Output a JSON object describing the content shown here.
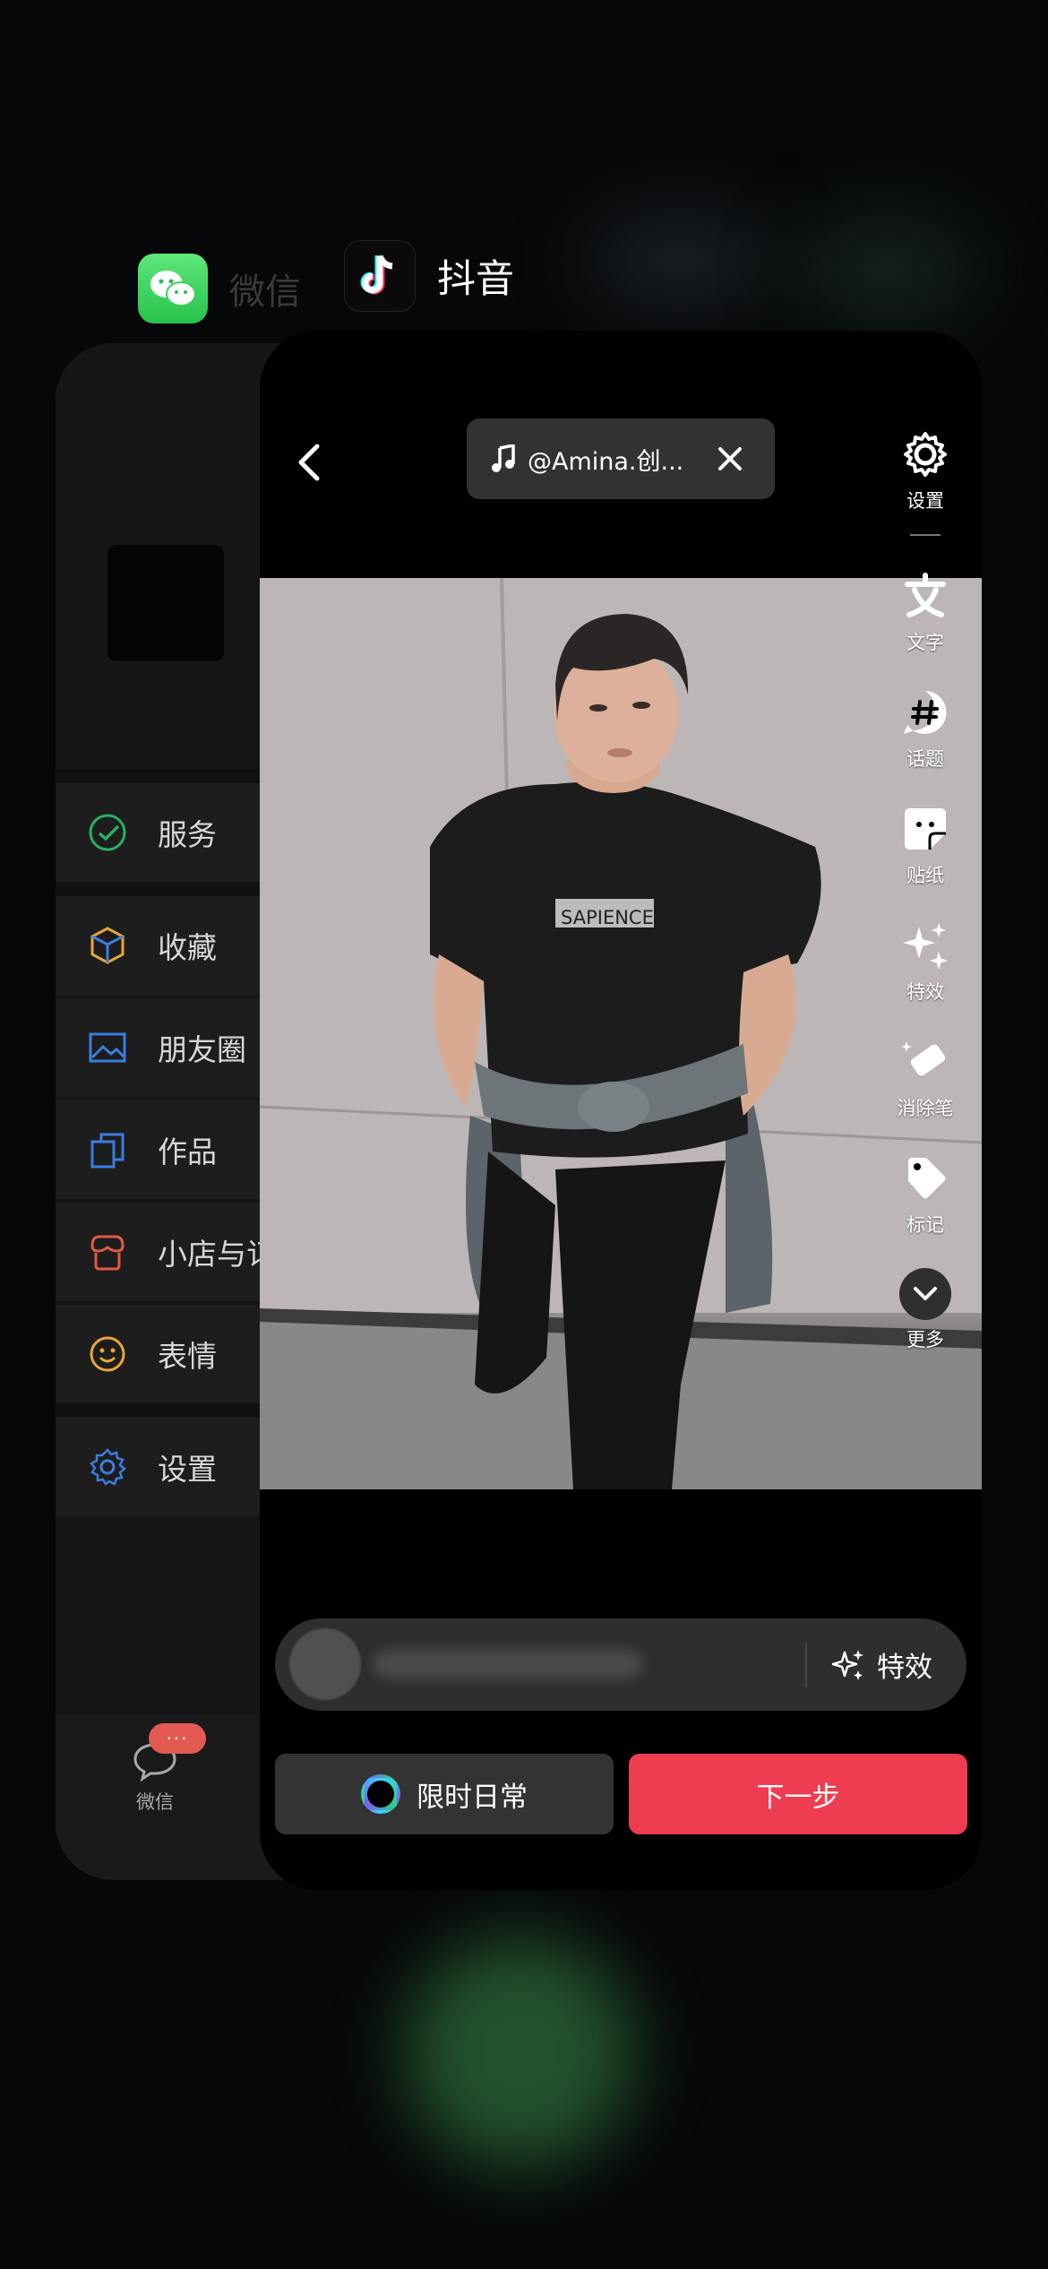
{
  "switcher": {
    "wechat_app_name": "微信",
    "douyin_app_name": "抖音"
  },
  "wechat": {
    "menu": [
      {
        "label": "服务",
        "icon": "service-icon",
        "color": "#2aae67"
      },
      {
        "label": "收藏",
        "icon": "cube-icon",
        "color": "#e6a63a"
      },
      {
        "label": "朋友圈",
        "icon": "image-icon",
        "color": "#3b7de0"
      },
      {
        "label": "作品",
        "icon": "copy-icon",
        "color": "#3b7de0"
      },
      {
        "label": "小店与订",
        "icon": "shop-icon",
        "color": "#e05a4a"
      },
      {
        "label": "表情",
        "icon": "smile-icon",
        "color": "#e6a63a"
      },
      {
        "label": "设置",
        "icon": "gear-icon",
        "color": "#3b7de0"
      }
    ],
    "tabbar": {
      "label": "微信",
      "badge": "···"
    }
  },
  "douyin": {
    "music_label": "@Amina.创...",
    "tools": [
      {
        "label": "设置",
        "icon": "gear-icon"
      },
      {
        "label": "文字",
        "icon": "text-icon"
      },
      {
        "label": "话题",
        "icon": "hashtag-icon"
      },
      {
        "label": "贴纸",
        "icon": "sticker-icon"
      },
      {
        "label": "特效",
        "icon": "sparkle-icon"
      },
      {
        "label": "消除笔",
        "icon": "eraser-icon"
      },
      {
        "label": "标记",
        "icon": "tag-icon"
      },
      {
        "label": "更多",
        "icon": "chevron-down-icon"
      }
    ],
    "photo_shirt_text": "SAPIENCE",
    "effects_label": "特效",
    "daily_label": "限时日常",
    "next_label": "下一步"
  }
}
